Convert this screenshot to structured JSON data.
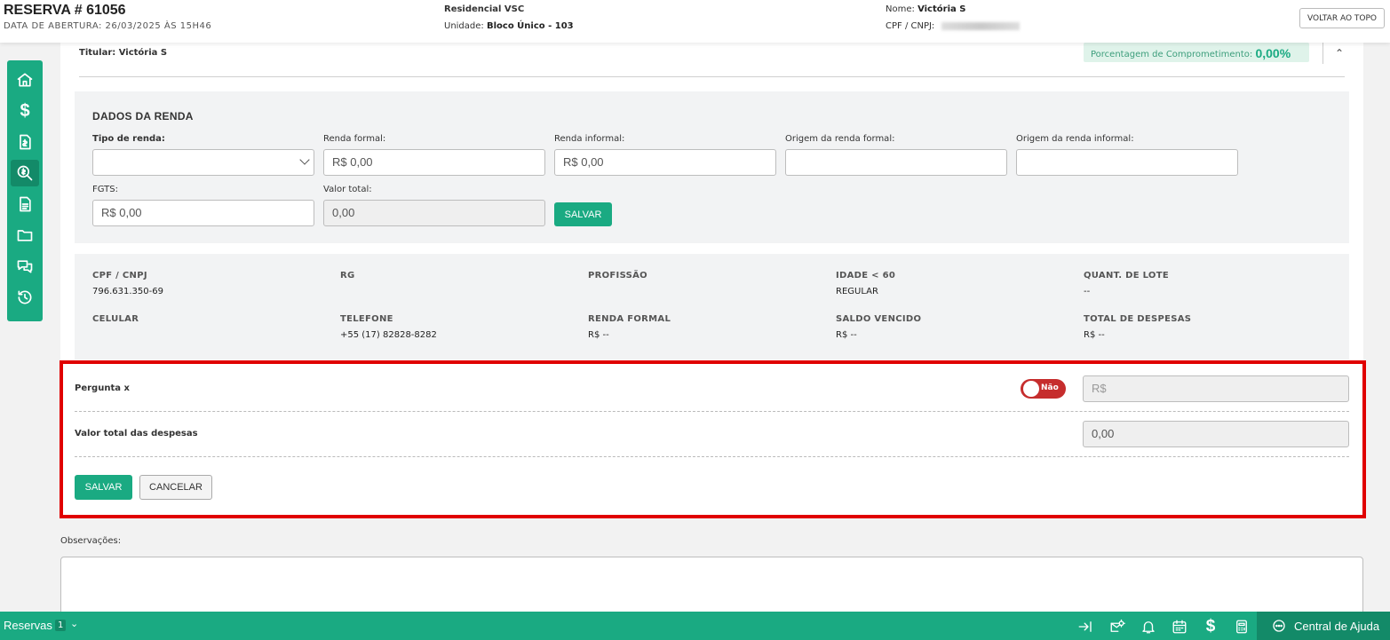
{
  "header": {
    "title": "RESERVA # 61056",
    "opened_label": "DATA DE ABERTURA: 26/03/2025 ÀS 15H46",
    "project": "Residencial VSC",
    "unit_label": "Unidade:",
    "unit_value": "Bloco Único - 103",
    "name_label": "Nome:",
    "name_value": "Victória S",
    "cpf_label": "CPF / CNPJ:",
    "back_to_top": "VOLTAR AO TOPO"
  },
  "sidebar": {
    "items": [
      "home-icon",
      "dollar-icon",
      "invoice-icon",
      "analysis-icon",
      "document-icon",
      "folder-icon",
      "chat-icon",
      "history-icon"
    ],
    "active_index": 3
  },
  "card": {
    "holder": "Titular: Victória S",
    "commitment_label": "Porcentagem de Comprometimento:",
    "commitment_value": "0,00%",
    "collapse_glyph": "⌃"
  },
  "renda": {
    "title": "DADOS DA RENDA",
    "tipo_label": "Tipo de renda:",
    "tipo_value": "",
    "formal_label": "Renda formal:",
    "formal_value": "R$ 0,00",
    "informal_label": "Renda informal:",
    "informal_value": "R$ 0,00",
    "origem_formal_label": "Origem da renda formal:",
    "origem_formal_value": "",
    "origem_informal_label": "Origem da renda informal:",
    "origem_informal_value": "",
    "fgts_label": "FGTS:",
    "fgts_value": "R$ 0,00",
    "total_label": "Valor total:",
    "total_value": "0,00",
    "save": "SALVAR"
  },
  "info": {
    "cpf_label": "CPF / CNPJ",
    "cpf_value": "796.631.350-69",
    "rg_label": "RG",
    "profissao_label": "PROFISSÃO",
    "idade_label": "IDADE < 60",
    "idade_value": "REGULAR",
    "lote_label": "QUANT. DE LOTE",
    "lote_value": "--",
    "celular_label": "CELULAR",
    "telefone_label": "TELEFONE",
    "telefone_value": "+55 (17) 82828-8282",
    "renda_formal_label": "RENDA FORMAL",
    "renda_formal_value": "R$ --",
    "saldo_label": "SALDO VENCIDO",
    "saldo_value": "R$ --",
    "despesas_label": "TOTAL DE DESPESAS",
    "despesas_value": "R$ --"
  },
  "expenses": {
    "question": "Pergunta x",
    "toggle_text": "Não",
    "toggle_state": false,
    "amount_placeholder": "R$",
    "total_label": "Valor total das despesas",
    "total_value": "0,00",
    "save": "SALVAR",
    "cancel": "CANCELAR",
    "highlight_color": "#e00000"
  },
  "observations": {
    "label": "Observações:",
    "value": ""
  },
  "bottombar": {
    "label": "Reservas",
    "count": "1",
    "icons": [
      "collapse-right-icon",
      "mail-settings-icon",
      "bell-icon",
      "calendar-icon",
      "dollar-icon",
      "calculator-icon"
    ],
    "help": "Central de Ajuda"
  },
  "colors": {
    "brand": "#1aaa82",
    "brand_dark": "#138a68",
    "toggle_off": "#c62d2d"
  }
}
